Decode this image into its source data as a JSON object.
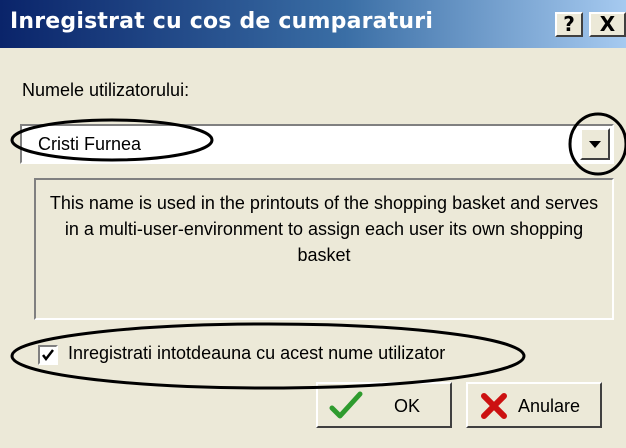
{
  "window": {
    "title": "Inregistrat cu cos de cumparaturi",
    "help_label": "?",
    "close_label": "X"
  },
  "user": {
    "label": "Numele utilizatorului:",
    "selected_value": "Cristi Furnea"
  },
  "description": "This name is used in the printouts of the shopping basket and serves in a multi-user-environment to assign each user its own shopping basket",
  "checkbox": {
    "label": "Inregistrati intotdeauna cu acest nume utilizator",
    "checked": true
  },
  "buttons": {
    "ok_label": "OK",
    "cancel_label": "Anulare"
  },
  "colors": {
    "titlebar_start": "#0a246a",
    "titlebar_end": "#a6caf0",
    "dialog_bg": "#ece9d8",
    "ok_icon": "#2e9b2e",
    "cancel_icon": "#cc1111"
  },
  "icons": {
    "ok": "checkmark-icon",
    "cancel": "red-x-icon",
    "dropdown": "chevron-down-icon"
  }
}
